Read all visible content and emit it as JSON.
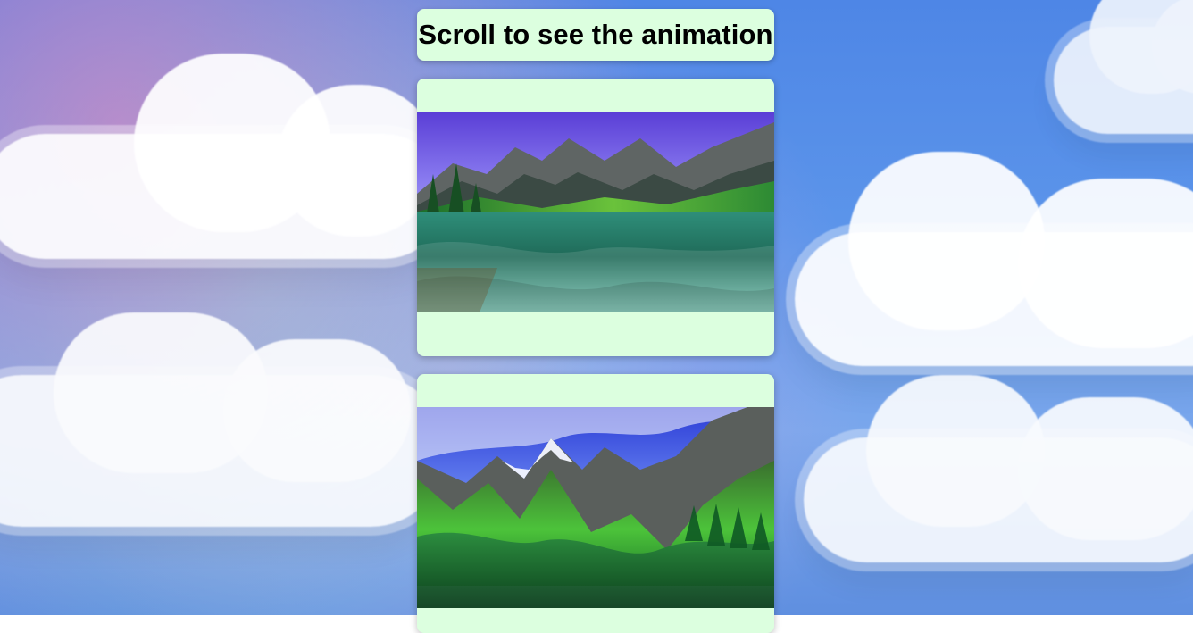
{
  "page": {
    "title_text": "Scroll to see the animation",
    "accent_colors": {
      "card_bg": "#dcffdf",
      "sky_blue": "#5c95ea"
    }
  },
  "cards": [
    {
      "image_icon": "mountain-lake-image"
    },
    {
      "image_icon": "mountain-valley-image"
    }
  ]
}
